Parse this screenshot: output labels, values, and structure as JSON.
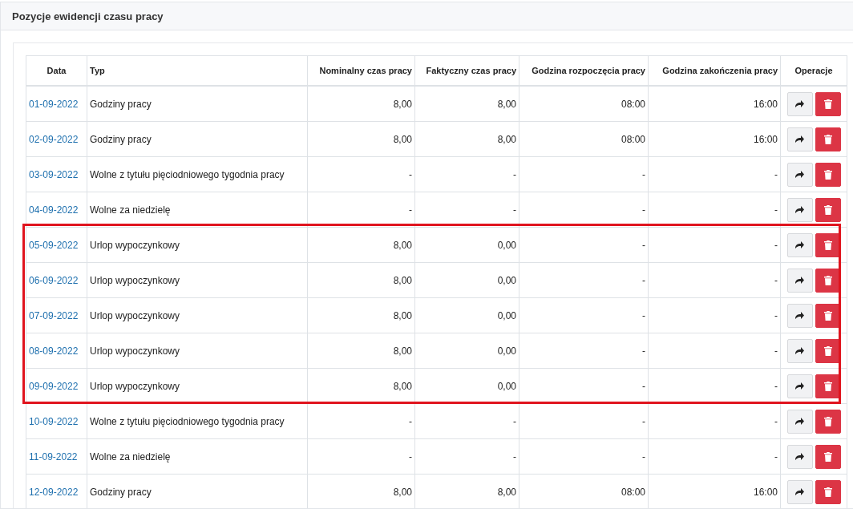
{
  "panel": {
    "title": "Pozycje ewidencji czasu pracy"
  },
  "table": {
    "columns": [
      "Data",
      "Typ",
      "Nominalny czas pracy",
      "Faktyczny czas pracy",
      "Godzina rozpoczęcia pracy",
      "Godzina zakończenia pracy",
      "Operacje"
    ],
    "rows": [
      {
        "date": "01-09-2022",
        "type": "Godziny pracy",
        "nominal": "8,00",
        "actual": "8,00",
        "start": "08:00",
        "end": "16:00",
        "highlighted": false
      },
      {
        "date": "02-09-2022",
        "type": "Godziny pracy",
        "nominal": "8,00",
        "actual": "8,00",
        "start": "08:00",
        "end": "16:00",
        "highlighted": false
      },
      {
        "date": "03-09-2022",
        "type": "Wolne z tytułu pięciodniowego tygodnia pracy",
        "nominal": "-",
        "actual": "-",
        "start": "-",
        "end": "-",
        "highlighted": false
      },
      {
        "date": "04-09-2022",
        "type": "Wolne za niedzielę",
        "nominal": "-",
        "actual": "-",
        "start": "-",
        "end": "-",
        "highlighted": false
      },
      {
        "date": "05-09-2022",
        "type": "Urlop wypoczynkowy",
        "nominal": "8,00",
        "actual": "0,00",
        "start": "-",
        "end": "-",
        "highlighted": true
      },
      {
        "date": "06-09-2022",
        "type": "Urlop wypoczynkowy",
        "nominal": "8,00",
        "actual": "0,00",
        "start": "-",
        "end": "-",
        "highlighted": true
      },
      {
        "date": "07-09-2022",
        "type": "Urlop wypoczynkowy",
        "nominal": "8,00",
        "actual": "0,00",
        "start": "-",
        "end": "-",
        "highlighted": true
      },
      {
        "date": "08-09-2022",
        "type": "Urlop wypoczynkowy",
        "nominal": "8,00",
        "actual": "0,00",
        "start": "-",
        "end": "-",
        "highlighted": true
      },
      {
        "date": "09-09-2022",
        "type": "Urlop wypoczynkowy",
        "nominal": "8,00",
        "actual": "0,00",
        "start": "-",
        "end": "-",
        "highlighted": true
      },
      {
        "date": "10-09-2022",
        "type": "Wolne z tytułu pięciodniowego tygodnia pracy",
        "nominal": "-",
        "actual": "-",
        "start": "-",
        "end": "-",
        "highlighted": false
      },
      {
        "date": "11-09-2022",
        "type": "Wolne za niedzielę",
        "nominal": "-",
        "actual": "-",
        "start": "-",
        "end": "-",
        "highlighted": false
      },
      {
        "date": "12-09-2022",
        "type": "Godziny pracy",
        "nominal": "8,00",
        "actual": "8,00",
        "start": "08:00",
        "end": "16:00",
        "highlighted": false
      }
    ]
  }
}
